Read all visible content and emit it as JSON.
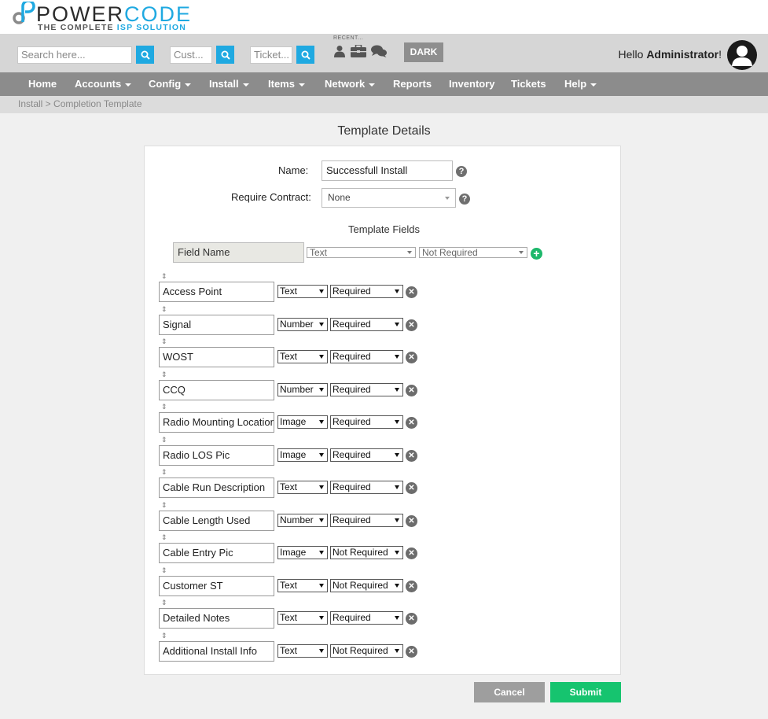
{
  "brand": {
    "name_part1": "POWER",
    "name_part2": "CODE",
    "tagline_part1": "THE COMPLETE ",
    "tagline_part2": "ISP SOLUTION",
    "accent_color": "#1fa9e1"
  },
  "topbar": {
    "search_placeholder": "Search here...",
    "customer_placeholder": "Cust...",
    "ticket_placeholder": "Ticket...",
    "recent_label": "RECENT...",
    "dark_button": "DARK",
    "greeting": "Hello ",
    "username": "Administrator",
    "greeting_suffix": "!"
  },
  "nav": {
    "items": [
      {
        "label": "Home",
        "dropdown": false
      },
      {
        "label": "Accounts",
        "dropdown": true
      },
      {
        "label": "Config",
        "dropdown": true
      },
      {
        "label": "Install",
        "dropdown": true
      },
      {
        "label": "Items",
        "dropdown": true
      },
      {
        "label": "Network",
        "dropdown": true
      },
      {
        "label": "Reports",
        "dropdown": false
      },
      {
        "label": "Inventory",
        "dropdown": false
      },
      {
        "label": "Tickets",
        "dropdown": false
      },
      {
        "label": "Help",
        "dropdown": true
      }
    ]
  },
  "breadcrumb": "Install > Completion Template",
  "page_title": "Template Details",
  "form": {
    "name_label": "Name:",
    "name_value": "Successfull Install",
    "contract_label": "Require Contract:",
    "contract_value": "None",
    "fields_title": "Template Fields",
    "new_field_placeholder": "Field Name",
    "new_field_type": "Text",
    "new_field_requirement": "Not Required"
  },
  "fields": [
    {
      "name": "Access Point",
      "type": "Text",
      "requirement": "Required"
    },
    {
      "name": "Signal",
      "type": "Number",
      "requirement": "Required"
    },
    {
      "name": "WOST",
      "type": "Text",
      "requirement": "Required"
    },
    {
      "name": "CCQ",
      "type": "Number",
      "requirement": "Required"
    },
    {
      "name": "Radio Mounting Location",
      "type": "Image",
      "requirement": "Required"
    },
    {
      "name": "Radio LOS Pic",
      "type": "Image",
      "requirement": "Required"
    },
    {
      "name": "Cable Run Description",
      "type": "Text",
      "requirement": "Required"
    },
    {
      "name": "Cable Length Used",
      "type": "Number",
      "requirement": "Required"
    },
    {
      "name": "Cable Entry Pic",
      "type": "Image",
      "requirement": "Not Required"
    },
    {
      "name": "Customer ST",
      "type": "Text",
      "requirement": "Not Required"
    },
    {
      "name": "Detailed Notes",
      "type": "Text",
      "requirement": "Required"
    },
    {
      "name": "Additional Install Info",
      "type": "Text",
      "requirement": "Not Required"
    }
  ],
  "buttons": {
    "cancel": "Cancel",
    "submit": "Submit",
    "submit_color": "#16c46f"
  }
}
